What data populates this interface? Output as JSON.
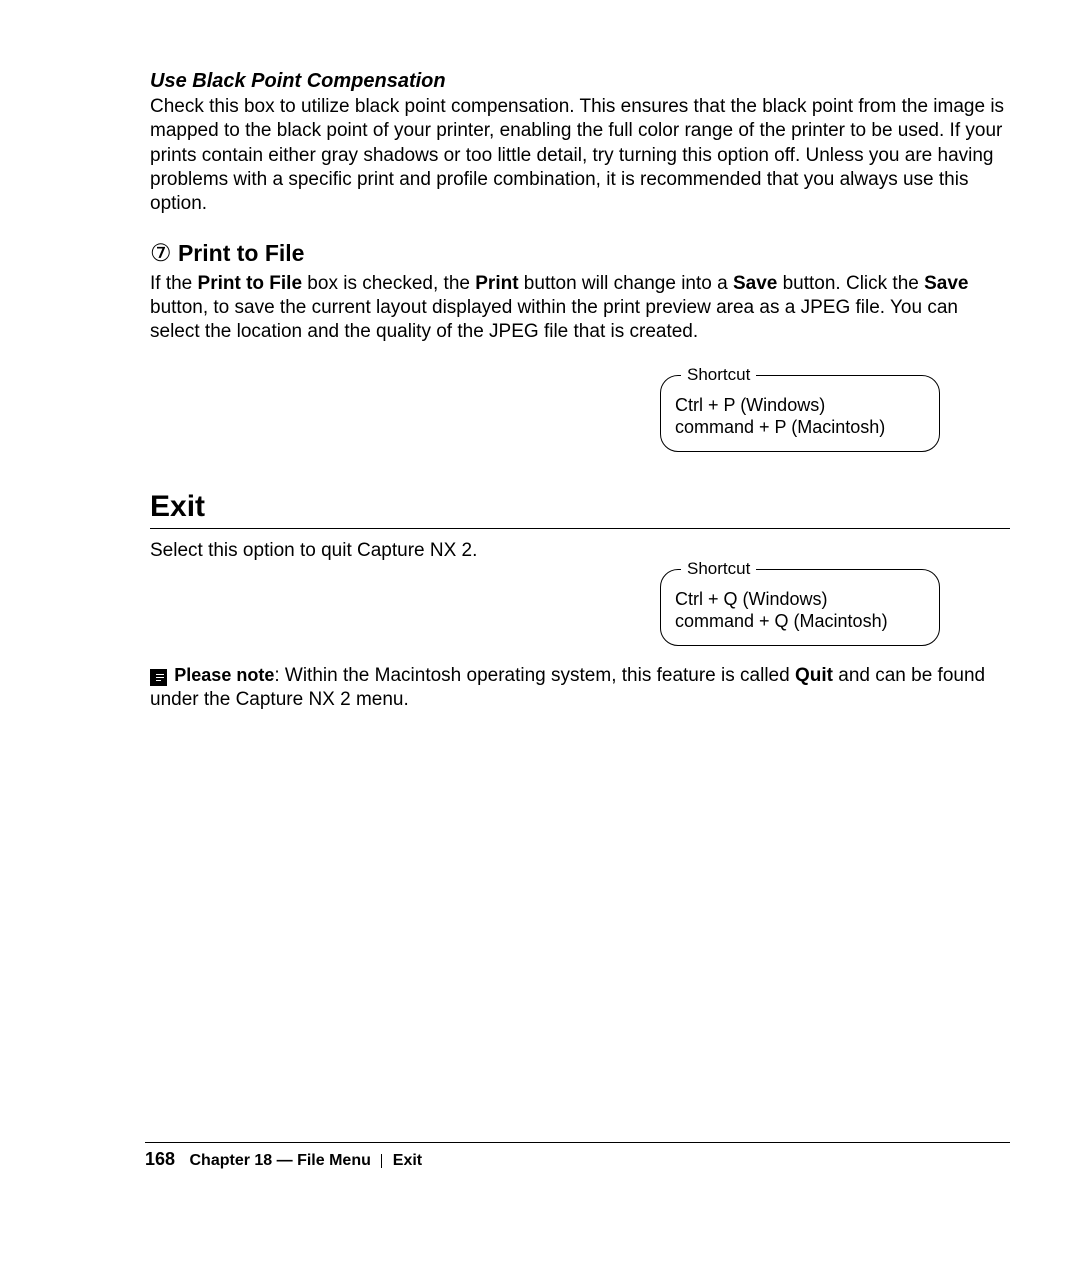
{
  "blackpoint": {
    "heading": "Use Black Point Compensation",
    "body": "Check this box to utilize black point compensation. This ensures that the black point from the image is mapped to the black point of your printer, enabling the full color range of the printer to be used. If your prints contain either gray shadows or too little detail, try turning this option off. Unless you are having problems with a specific print and profile combination, it is recommended that you always use this option."
  },
  "print_to_file": {
    "num": "⑦",
    "title": "Print to File",
    "p_pre": "If the ",
    "p_b1": "Print to File",
    "p_mid1": " box is checked, the ",
    "p_b2": "Print",
    "p_mid2": " button will change into a ",
    "p_b3": "Save",
    "p_mid3": " button. Click the ",
    "p_b4": "Save",
    "p_post": " button, to save the current layout displayed within the print preview area as a JPEG file. You can select the location and the quality of the JPEG file that is created.",
    "shortcut_label": "Shortcut",
    "shortcut_win": "Ctrl + P (Windows)",
    "shortcut_mac": "command + P (Macintosh)"
  },
  "exit": {
    "title": "Exit",
    "body": "Select this option to quit Capture NX 2.",
    "shortcut_label": "Shortcut",
    "shortcut_win": "Ctrl + Q (Windows)",
    "shortcut_mac": "command + Q (Macintosh)",
    "note_label": "Please note",
    "note_pre": ": Within the Macintosh operating system, this feature is called ",
    "note_bold": "Quit",
    "note_post": " and can be found under the Capture NX 2 menu."
  },
  "footer": {
    "page": "168",
    "chapter": "Chapter 18 — File Menu",
    "section": "Exit"
  }
}
